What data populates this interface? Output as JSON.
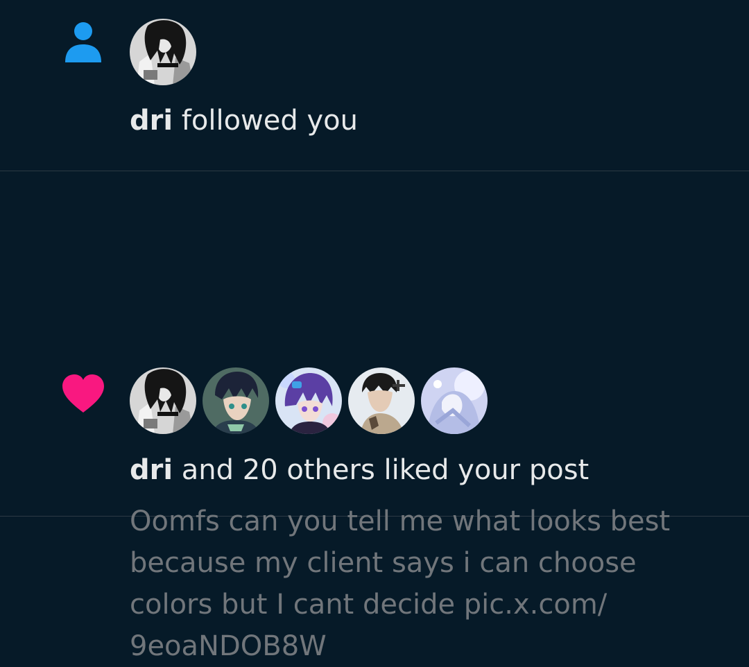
{
  "notifications": [
    {
      "type": "follow",
      "icon": "person-icon",
      "icon_color": "#1d9bf0",
      "actor": "dri",
      "action": "followed you",
      "avatars": [
        "dri"
      ]
    },
    {
      "type": "like",
      "icon": "heart-icon",
      "icon_color": "#f91880",
      "actor": "dri",
      "action": "and 20 others liked your post",
      "avatars": [
        "dri",
        "user-2",
        "user-3",
        "user-4",
        "user-5"
      ],
      "post_text": "Oomfs can you tell me what looks best\nbecause my client says i can choose\ncolors but I cant decide pic.x.com/\n9eoaNDOB8W"
    }
  ],
  "theme": {
    "background": "#061a28",
    "text_primary": "#e7e9ea",
    "text_secondary": "#71767b",
    "divider": "#2c3a44"
  }
}
